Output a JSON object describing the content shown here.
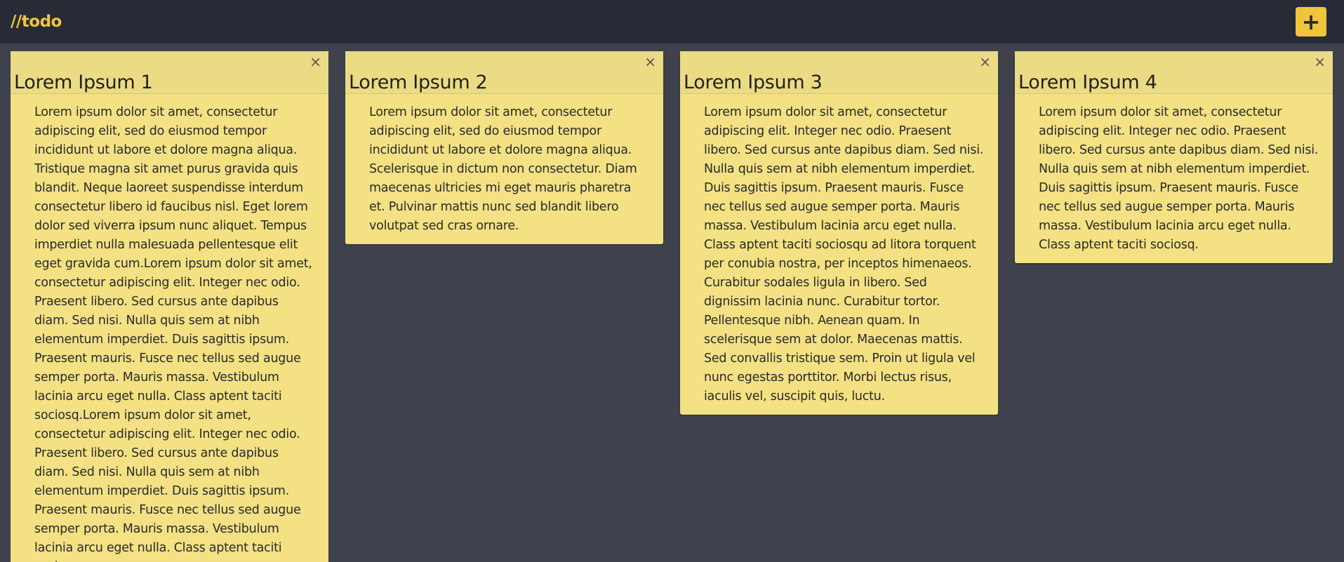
{
  "app": {
    "brand": "//todo",
    "add_button_label": "+"
  },
  "notes": [
    {
      "title": "Lorem Ipsum 1",
      "close_label": "×",
      "body": "Lorem ipsum dolor sit amet, consectetur adipiscing elit, sed do eiusmod tempor incididunt ut labore et dolore magna aliqua. Tristique magna sit amet purus gravida quis blandit. Neque laoreet suspendisse interdum consectetur libero id faucibus nisl. Eget lorem dolor sed viverra ipsum nunc aliquet. Tempus imperdiet nulla malesuada pellentesque elit eget gravida cum.Lorem ipsum dolor sit amet, consectetur adipiscing elit. Integer nec odio. Praesent libero. Sed cursus ante dapibus diam. Sed nisi. Nulla quis sem at nibh elementum imperdiet. Duis sagittis ipsum. Praesent mauris. Fusce nec tellus sed augue semper porta. Mauris massa. Vestibulum lacinia arcu eget nulla. Class aptent taciti sociosq.Lorem ipsum dolor sit amet, consectetur adipiscing elit. Integer nec odio. Praesent libero. Sed cursus ante dapibus diam. Sed nisi. Nulla quis sem at nibh elementum imperdiet. Duis sagittis ipsum. Praesent mauris. Fusce nec tellus sed augue semper porta. Mauris massa. Vestibulum lacinia arcu eget nulla. Class aptent taciti sociosq."
    },
    {
      "title": "Lorem Ipsum 2",
      "close_label": "×",
      "body": "Lorem ipsum dolor sit amet, consectetur adipiscing elit, sed do eiusmod tempor incididunt ut labore et dolore magna aliqua. Scelerisque in dictum non consectetur. Diam maecenas ultricies mi eget mauris pharetra et. Pulvinar mattis nunc sed blandit libero volutpat sed cras ornare."
    },
    {
      "title": "Lorem Ipsum 3",
      "close_label": "×",
      "body": "Lorem ipsum dolor sit amet, consectetur adipiscing elit. Integer nec odio. Praesent libero. Sed cursus ante dapibus diam. Sed nisi. Nulla quis sem at nibh elementum imperdiet. Duis sagittis ipsum. Praesent mauris. Fusce nec tellus sed augue semper porta. Mauris massa. Vestibulum lacinia arcu eget nulla. Class aptent taciti sociosqu ad litora torquent per conubia nostra, per inceptos himenaeos. Curabitur sodales ligula in libero. Sed dignissim lacinia nunc. Curabitur tortor. Pellentesque nibh. Aenean quam. In scelerisque sem at dolor. Maecenas mattis. Sed convallis tristique sem. Proin ut ligula vel nunc egestas porttitor. Morbi lectus risus, iaculis vel, suscipit quis, luctu."
    },
    {
      "title": "Lorem Ipsum 4",
      "close_label": "×",
      "body": "Lorem ipsum dolor sit amet, consectetur adipiscing elit. Integer nec odio. Praesent libero. Sed cursus ante dapibus diam. Sed nisi. Nulla quis sem at nibh elementum imperdiet. Duis sagittis ipsum. Praesent mauris. Fusce nec tellus sed augue semper porta. Mauris massa. Vestibulum lacinia arcu eget nulla. Class aptent taciti sociosq."
    }
  ],
  "colors": {
    "background": "#3f424d",
    "navbar": "#272b36",
    "accent": "#f0c43b",
    "note": "#f3e184",
    "note_header": "#ebdb84"
  }
}
